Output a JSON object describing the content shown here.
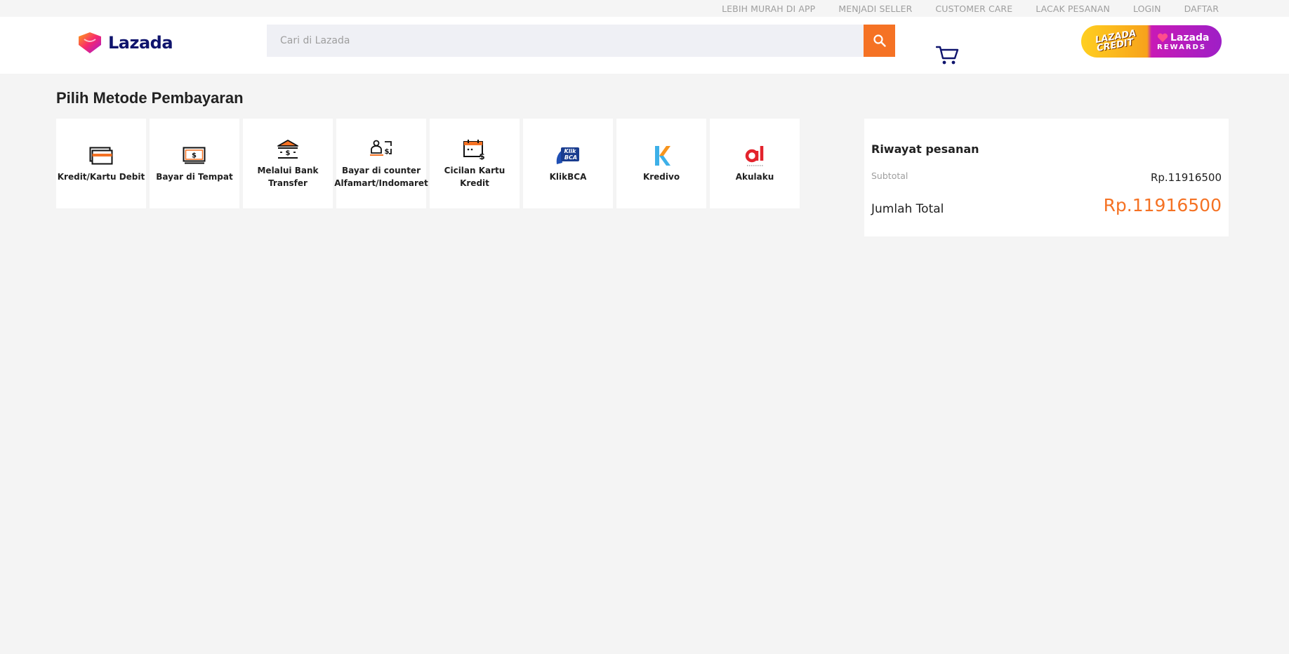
{
  "topbar": {
    "links": [
      "LEBIH MURAH DI APP",
      "MENJADI SELLER",
      "CUSTOMER CARE",
      "LACAK PESANAN",
      "LOGIN",
      "DAFTAR"
    ]
  },
  "header": {
    "logo_text": "Lazada",
    "search_placeholder": "Cari di Lazada",
    "promo": {
      "left_text_line1": "LAZADA",
      "left_text_line2": "CREDIT",
      "right_brand": "Lazada",
      "right_sub": "REWARDS"
    }
  },
  "page": {
    "title": "Pilih Metode Pembayaran"
  },
  "methods": [
    {
      "label": "Kredit/Kartu Debit",
      "icon": "credit-card-icon"
    },
    {
      "label": "Bayar di Tempat",
      "icon": "cash-icon"
    },
    {
      "label": "Melalui Bank Transfer",
      "icon": "bank-icon"
    },
    {
      "label": "Bayar di counter Alfamart/Indomaret",
      "icon": "counter-icon"
    },
    {
      "label": "Cicilan Kartu Kredit",
      "icon": "installment-calendar-icon"
    },
    {
      "label": "KlikBCA",
      "icon": "klikbca-logo"
    },
    {
      "label": "Kredivo",
      "icon": "kredivo-logo"
    },
    {
      "label": "Akulaku",
      "icon": "akulaku-logo"
    }
  ],
  "summary": {
    "title": "Riwayat pesanan",
    "subtotal_label": "Subtotal",
    "subtotal_value": "Rp.11916500",
    "total_label": "Jumlah Total",
    "total_value": "Rp.11916500"
  },
  "colors": {
    "accent": "#f57224",
    "brand_navy": "#0f146d",
    "background": "#f4f4f4"
  }
}
